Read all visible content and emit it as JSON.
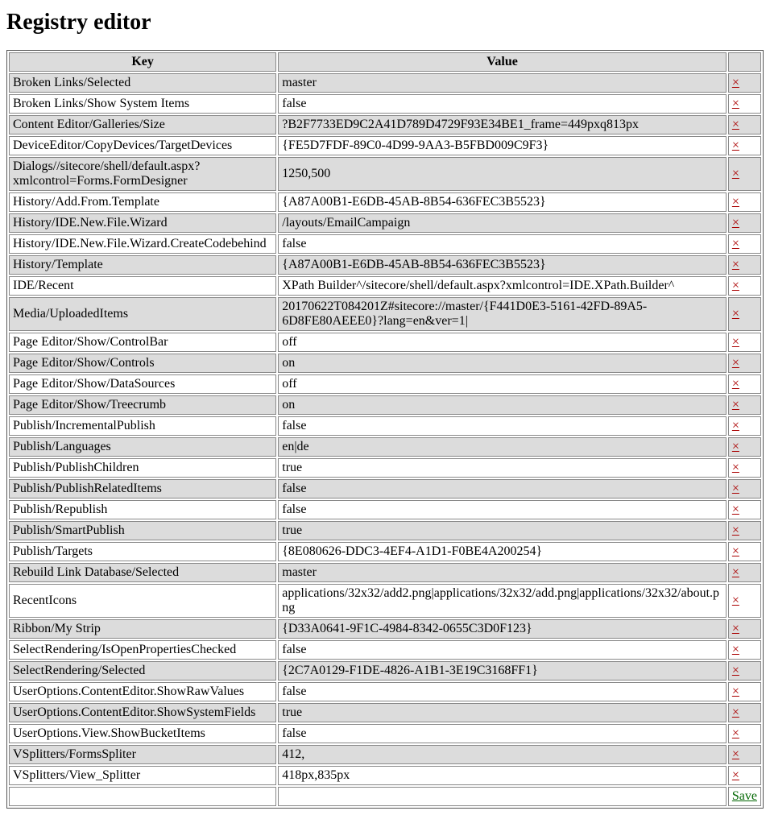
{
  "title": "Registry editor",
  "columns": {
    "key": "Key",
    "value": "Value"
  },
  "delete_symbol": "×",
  "save_label": "Save",
  "rows": [
    {
      "key": "Broken Links/Selected",
      "value": "master"
    },
    {
      "key": "Broken Links/Show System Items",
      "value": "false"
    },
    {
      "key": "Content Editor/Galleries/Size",
      "value": "?B2F7733ED9C2A41D789D4729F93E34BE1_frame=449pxq813px"
    },
    {
      "key": "DeviceEditor/CopyDevices/TargetDevices",
      "value": "{FE5D7FDF-89C0-4D99-9AA3-B5FBD009C9F3}"
    },
    {
      "key": "Dialogs//sitecore/shell/default.aspx?xmlcontrol=Forms.FormDesigner",
      "value": "1250,500"
    },
    {
      "key": "History/Add.From.Template",
      "value": "{A87A00B1-E6DB-45AB-8B54-636FEC3B5523}"
    },
    {
      "key": "History/IDE.New.File.Wizard",
      "value": "/layouts/EmailCampaign"
    },
    {
      "key": "History/IDE.New.File.Wizard.CreateCodebehind",
      "value": "false"
    },
    {
      "key": "History/Template",
      "value": "{A87A00B1-E6DB-45AB-8B54-636FEC3B5523}"
    },
    {
      "key": "IDE/Recent",
      "value": "XPath Builder^/sitecore/shell/default.aspx?xmlcontrol=IDE.XPath.Builder^"
    },
    {
      "key": "Media/UploadedItems",
      "value": "20170622T084201Z#sitecore://master/{F441D0E3-5161-42FD-89A5-6D8FE80AEEE0}?lang=en&ver=1|"
    },
    {
      "key": "Page Editor/Show/ControlBar",
      "value": "off"
    },
    {
      "key": "Page Editor/Show/Controls",
      "value": "on"
    },
    {
      "key": "Page Editor/Show/DataSources",
      "value": "off"
    },
    {
      "key": "Page Editor/Show/Treecrumb",
      "value": "on"
    },
    {
      "key": "Publish/IncrementalPublish",
      "value": "false"
    },
    {
      "key": "Publish/Languages",
      "value": "en|de"
    },
    {
      "key": "Publish/PublishChildren",
      "value": "true"
    },
    {
      "key": "Publish/PublishRelatedItems",
      "value": "false"
    },
    {
      "key": "Publish/Republish",
      "value": "false"
    },
    {
      "key": "Publish/SmartPublish",
      "value": "true"
    },
    {
      "key": "Publish/Targets",
      "value": "{8E080626-DDC3-4EF4-A1D1-F0BE4A200254}"
    },
    {
      "key": "Rebuild Link Database/Selected",
      "value": "master"
    },
    {
      "key": "RecentIcons",
      "value": "applications/32x32/add2.png|applications/32x32/add.png|applications/32x32/about.png"
    },
    {
      "key": "Ribbon/My Strip",
      "value": "{D33A0641-9F1C-4984-8342-0655C3D0F123}"
    },
    {
      "key": "SelectRendering/IsOpenPropertiesChecked",
      "value": "false"
    },
    {
      "key": "SelectRendering/Selected",
      "value": "{2C7A0129-F1DE-4826-A1B1-3E19C3168FF1}"
    },
    {
      "key": "UserOptions.ContentEditor.ShowRawValues",
      "value": "false"
    },
    {
      "key": "UserOptions.ContentEditor.ShowSystemFields",
      "value": "true"
    },
    {
      "key": "UserOptions.View.ShowBucketItems",
      "value": "false"
    },
    {
      "key": "VSplitters/FormsSpliter",
      "value": "412,"
    },
    {
      "key": "VSplitters/View_Splitter",
      "value": "418px,835px"
    }
  ]
}
